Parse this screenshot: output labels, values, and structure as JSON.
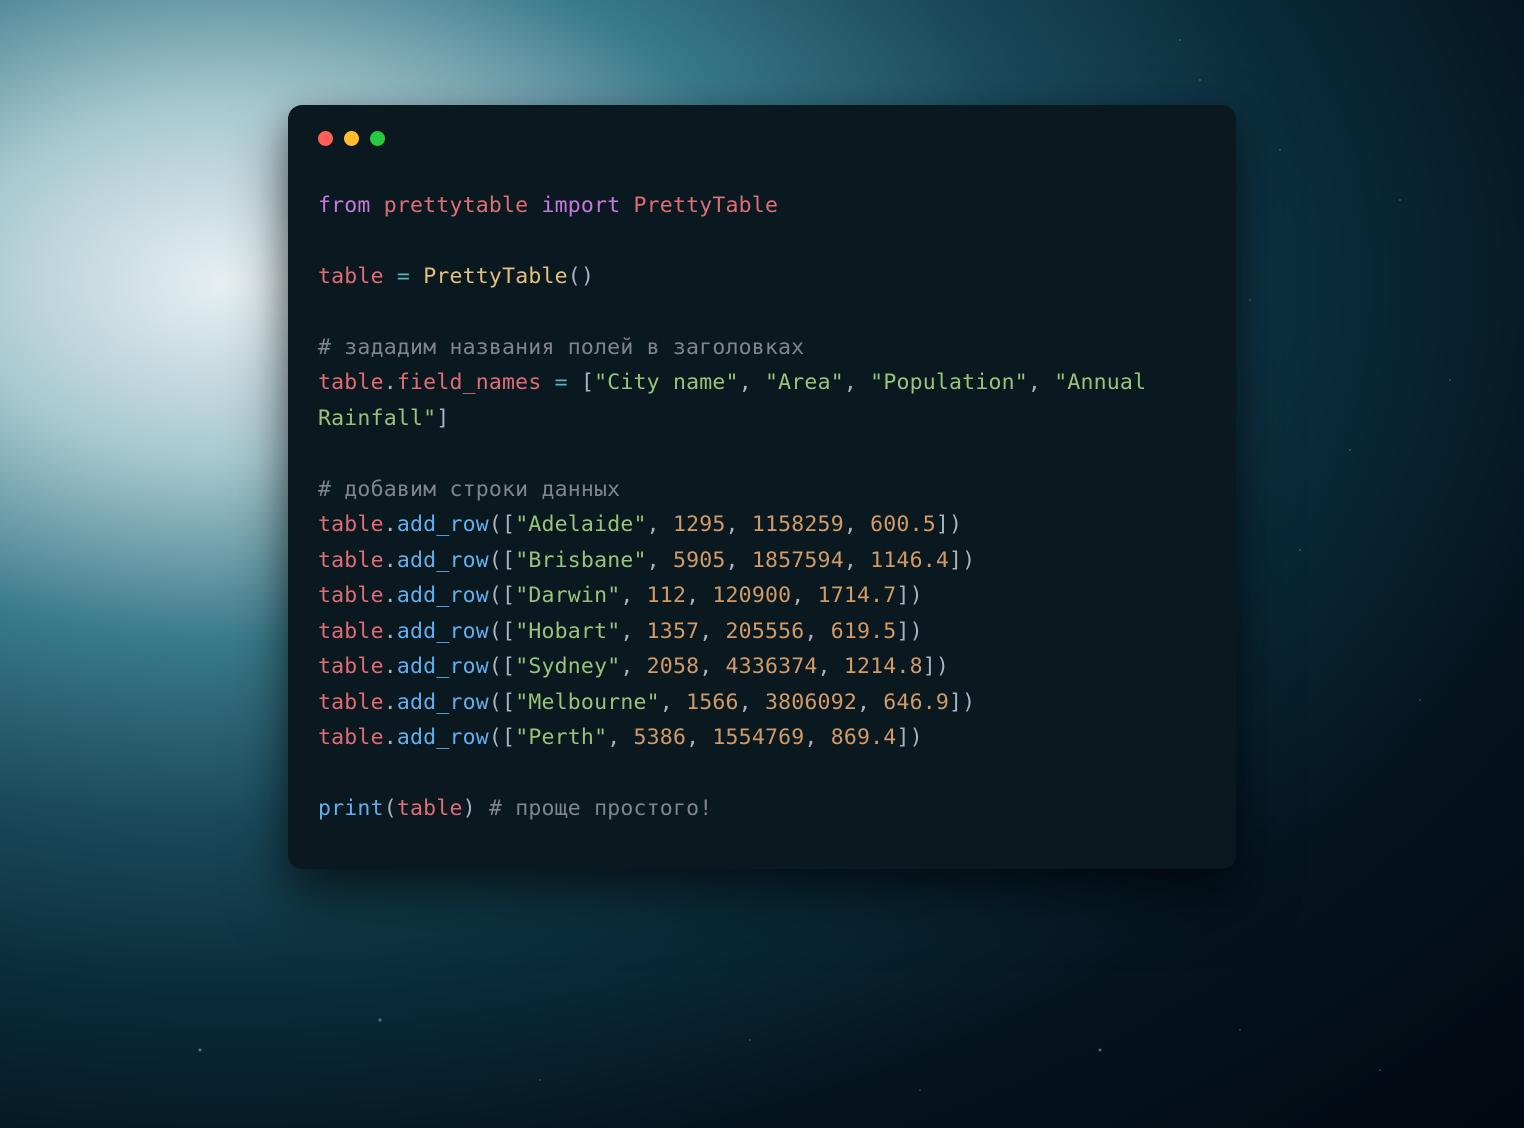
{
  "traffic_lights": {
    "red": "#ff5f56",
    "yellow": "#ffbd2e",
    "green": "#27c93f"
  },
  "code": {
    "line1": {
      "kw_from": "from",
      "module": "prettytable",
      "kw_import": "import",
      "cls": "PrettyTable"
    },
    "line2": {
      "var": "table",
      "eq": "=",
      "cls": "PrettyTable",
      "paren": "()"
    },
    "comment_fields": "# зададим названия полей в заголовках",
    "field_assign": {
      "var": "table",
      "dot": ".",
      "attr": "field_names",
      "eq": "=",
      "open": "[",
      "f0": "\"City name\"",
      "c": ", ",
      "f1": "\"Area\"",
      "f2": "\"Population\"",
      "f3": "\"Annual Rainfall\"",
      "close": "]"
    },
    "comment_rows": "# добавим строки данных",
    "rows": [
      {
        "city": "\"Adelaide\"",
        "n0": "1295",
        "n1": "1158259",
        "n2": "600.5"
      },
      {
        "city": "\"Brisbane\"",
        "n0": "5905",
        "n1": "1857594",
        "n2": "1146.4"
      },
      {
        "city": "\"Darwin\"",
        "n0": "112",
        "n1": "120900",
        "n2": "1714.7"
      },
      {
        "city": "\"Hobart\"",
        "n0": "1357",
        "n1": "205556",
        "n2": "619.5"
      },
      {
        "city": "\"Sydney\"",
        "n0": "2058",
        "n1": "4336374",
        "n2": "1214.8"
      },
      {
        "city": "\"Melbourne\"",
        "n0": "1566",
        "n1": "3806092",
        "n2": "646.9"
      },
      {
        "city": "\"Perth\"",
        "n0": "5386",
        "n1": "1554769",
        "n2": "869.4"
      }
    ],
    "row_tpl": {
      "var": "table",
      "dot": ".",
      "fn": "add_row",
      "open": "([",
      "c": ", ",
      "close": "])"
    },
    "print_line": {
      "fn": "print",
      "open": "(",
      "arg": "table",
      "close": ")",
      "sp": " ",
      "comment": "# проще простого!"
    }
  }
}
